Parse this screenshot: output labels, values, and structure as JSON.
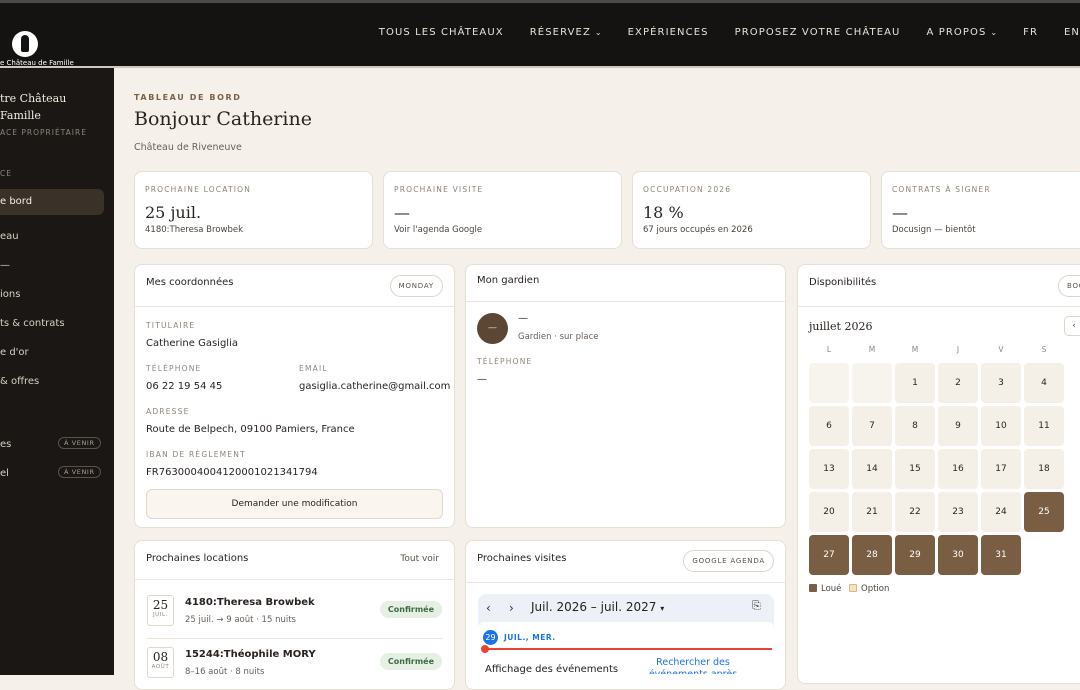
{
  "nav": {
    "logo_text": "e Château de Famille",
    "links": [
      {
        "label": "TOUS LES CHÂTEAUX",
        "dropdown": false
      },
      {
        "label": "RÉSERVEZ",
        "dropdown": true
      },
      {
        "label": "EXPÉRIENCES",
        "dropdown": false
      },
      {
        "label": "PROPOSEZ VOTRE CHÂTEAU",
        "dropdown": false
      },
      {
        "label": "A PROPOS",
        "dropdown": true
      },
      {
        "label": "FR",
        "dropdown": false
      },
      {
        "label": "EN",
        "dropdown": false
      }
    ]
  },
  "sidebar": {
    "title_line1": "tre Château",
    "title_line2": "Famille",
    "subtitle": "ACE PROPRIÉTAIRE",
    "section": "CE",
    "items": [
      {
        "label": "e bord",
        "active": true
      },
      {
        "label": "eau"
      },
      {
        "label": "—"
      },
      {
        "label": "ions"
      },
      {
        "label": "ts & contrats"
      },
      {
        "label": "e d'or"
      },
      {
        "label": "& offres"
      },
      {
        "label": "es",
        "badge": "À VENIR"
      },
      {
        "label": "el",
        "badge": "À VENIR"
      }
    ]
  },
  "header": {
    "eyebrow": "TABLEAU DE BORD",
    "greeting": "Bonjour Catherine",
    "chateau": "Château de Riveneuve"
  },
  "stats": [
    {
      "label": "PROCHAINE LOCATION",
      "value": "25 juil.",
      "sub": "4180:Theresa Browbek"
    },
    {
      "label": "PROCHAINE VISITE",
      "value": "—",
      "sub": "Voir l'agenda Google"
    },
    {
      "label": "OCCUPATION 2026",
      "value": "18 %",
      "sub": "67 jours occupés en 2026"
    },
    {
      "label": "CONTRATS À SIGNER",
      "value": "—",
      "sub": "Docusign — bientôt"
    }
  ],
  "coords": {
    "title": "Mes coordonnées",
    "pill": "MONDAY",
    "titulaire_label": "TITULAIRE",
    "titulaire": "Catherine Gasiglia",
    "tel_label": "TÉLÉPHONE",
    "tel": "06 22 19 54 45",
    "email_label": "EMAIL",
    "email": "gasiglia.catherine@gmail.com",
    "adresse_label": "ADRESSE",
    "adresse": "Route de Belpech, 09100 Pamiers, France",
    "iban_label": "IBAN DE RÈGLEMENT",
    "iban": "FR7630004004120001021341794",
    "button": "Demander une modification"
  },
  "gardien": {
    "title": "Mon gardien",
    "avatar": "—",
    "name": "—",
    "role": "Gardien · sur place",
    "tel_label": "TÉLÉPHONE",
    "tel": "—"
  },
  "dispo": {
    "title": "Disponibilités",
    "pill": "BOO",
    "month": "juillet 2026",
    "nav_prev": "‹",
    "weekdays": [
      "L",
      "M",
      "M",
      "J",
      "V",
      "S"
    ],
    "weeks": [
      [
        {
          "d": ""
        },
        {
          "d": ""
        },
        {
          "d": "1"
        },
        {
          "d": "2"
        },
        {
          "d": "3"
        },
        {
          "d": "4"
        }
      ],
      [
        {
          "d": "6"
        },
        {
          "d": "7"
        },
        {
          "d": "8"
        },
        {
          "d": "9"
        },
        {
          "d": "10"
        },
        {
          "d": "11"
        }
      ],
      [
        {
          "d": "13"
        },
        {
          "d": "14"
        },
        {
          "d": "15"
        },
        {
          "d": "16"
        },
        {
          "d": "17"
        },
        {
          "d": "18"
        }
      ],
      [
        {
          "d": "20"
        },
        {
          "d": "21"
        },
        {
          "d": "22"
        },
        {
          "d": "23"
        },
        {
          "d": "24"
        },
        {
          "d": "25",
          "rented": true
        }
      ],
      [
        {
          "d": "27",
          "rented": true
        },
        {
          "d": "28",
          "rented": true
        },
        {
          "d": "29",
          "rented": true
        },
        {
          "d": "30",
          "rented": true
        },
        {
          "d": "31",
          "rented": true
        }
      ]
    ],
    "legend_rented": "Loué",
    "legend_option": "Option",
    "color_rented": "#7a5e44",
    "color_option": "#f3e3c2"
  },
  "locations": {
    "title": "Prochaines locations",
    "link": "Tout voir",
    "items": [
      {
        "day": "25",
        "month": "JUIL.",
        "name": "4180:Theresa Browbek",
        "sub": "25 juil. → 9 août · 15 nuits",
        "status": "Confirmée"
      },
      {
        "day": "08",
        "month": "AOÛT",
        "name": "15244:Théophile MORY",
        "sub": "8–16 août · 8 nuits",
        "status": "Confirmée"
      }
    ]
  },
  "visites": {
    "title": "Prochaines visites",
    "pill": "GOOGLE AGENDA",
    "range": "Juil. 2026 – juil. 2027",
    "day_num": "29",
    "day_label": "JUIL., MER.",
    "event_label": "Affichage des événements",
    "search": "Rechercher des événements après cette"
  }
}
